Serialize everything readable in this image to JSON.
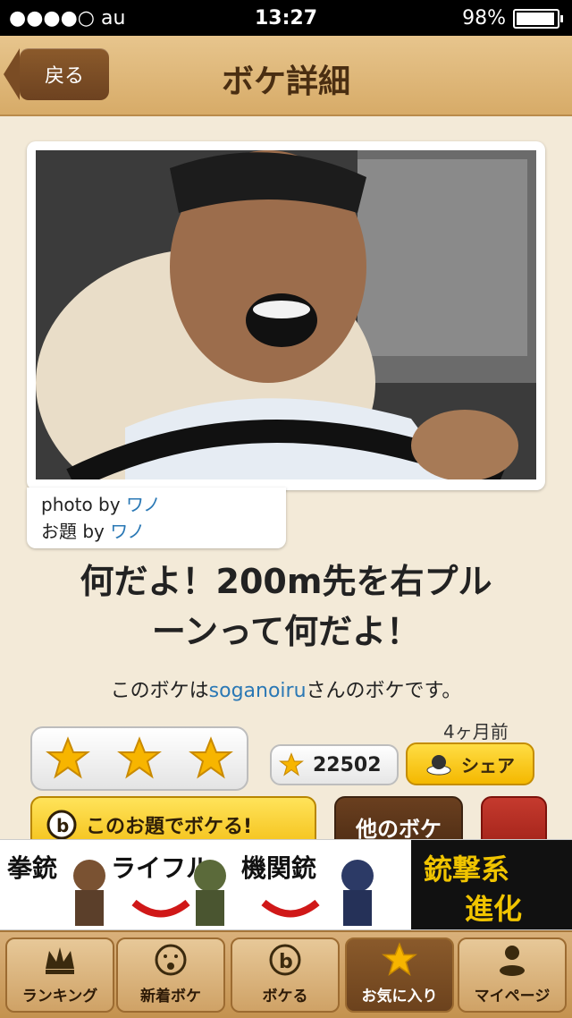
{
  "status_bar": {
    "carrier": "●●●●○ au",
    "time": "13:27",
    "battery": "98%"
  },
  "nav": {
    "back_label": "戻る",
    "title": "ボケ詳細"
  },
  "credits": {
    "photo_prefix": "photo by ",
    "photo_author": "ワノ",
    "topic_prefix": "お題 by ",
    "topic_author": "ワノ"
  },
  "boke": {
    "line1": "何だよ！200m先を右プル",
    "line2": "ーンって何だよ！",
    "author_prefix": "このボケは",
    "author": "soganoiru",
    "author_suffix": "さんのボケです。",
    "time_ago": "4ヶ月前",
    "rating_stars": 3,
    "favorite_count": "22502"
  },
  "actions": {
    "share_label": "シェア",
    "boke_button_label": "このお題でボケる!",
    "other_label": "他のボケ"
  },
  "ad": {
    "w1": "拳銃",
    "w2": "ライフル",
    "w3": "機関銃",
    "right1": "銃撃系",
    "right2": "進化"
  },
  "tabs": [
    {
      "label": "ランキング",
      "icon": "crown-icon"
    },
    {
      "label": "新着ボケ",
      "icon": "face-icon"
    },
    {
      "label": "ボケる",
      "icon": "b-logo-icon"
    },
    {
      "label": "お気に入り",
      "icon": "star-icon"
    },
    {
      "label": "マイページ",
      "icon": "person-icon"
    }
  ],
  "colors": {
    "accent_link": "#2a78b5",
    "nav_wood": "#d7ab68",
    "brown": "#6d4220"
  }
}
